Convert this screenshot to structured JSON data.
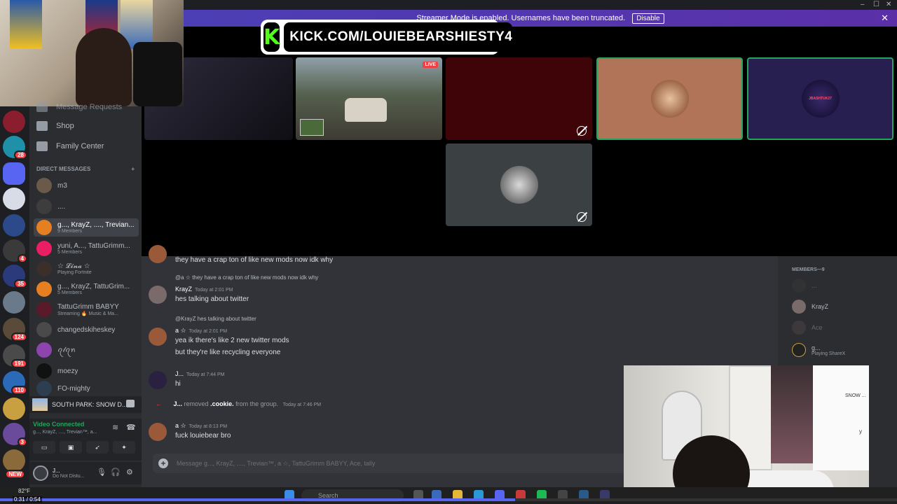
{
  "banner": {
    "text": "Streamer Mode is enabled. Usernames have been truncated.",
    "disable_label": "Disable",
    "close_label": "✕"
  },
  "window_controls": [
    "–",
    "☐",
    "✕"
  ],
  "kick_overlay": {
    "logo_letter": "K",
    "url": "KICK.COM/LOUIEBEARSHIESTY4"
  },
  "stage": {
    "live_label": "LIVE",
    "tiles": [
      {
        "name": "stream-tile-room",
        "color": "#1b1925"
      },
      {
        "name": "stream-tile-gta",
        "color": "#6a6f5c"
      },
      {
        "name": "participant-tile-red",
        "color": "#3e0408"
      },
      {
        "name": "participant-tile-orange",
        "color": "#b27458"
      },
      {
        "name": "participant-tile-navy",
        "color": "#271f4f"
      },
      {
        "name": "participant-tile-gray",
        "color": "#3b4043"
      }
    ],
    "navy_avatar_text": "JBASHTUK27"
  },
  "servers": {
    "badges": [
      "28",
      "4",
      "35",
      "124",
      "191",
      "110",
      "3",
      "NEW"
    ]
  },
  "dm_sidebar": {
    "nav": {
      "message_requests": "Message Requests",
      "shop": "Shop",
      "family_center": "Family Center"
    },
    "header": "DIRECT MESSAGES",
    "add": "+",
    "items": [
      {
        "name": "m3",
        "sub": "",
        "color": "#6b5a4a"
      },
      {
        "name": "....",
        "sub": "",
        "color": "#3d3d3d"
      },
      {
        "name": "g..., KrayZ, ...., Trevian...",
        "sub": "9 Members",
        "color": "#e67e22"
      },
      {
        "name": "yuni, A..., TattuGrimm...",
        "sub": "5 Members",
        "color": "#e91e63"
      },
      {
        "name": "☆ 𝓛𝓲𝓷𝓪 ☆",
        "sub": "Playing Fortnite",
        "color": "#3a2f2a"
      },
      {
        "name": "g..., KrayZ, TattuGrim...",
        "sub": "5 Members",
        "color": "#e67e22"
      },
      {
        "name": "TattuGrimm BABYY",
        "sub": "Streaming 🔥 Music & Ma...",
        "color": "#5a1a2a"
      },
      {
        "name": "changedskiheskey",
        "sub": "",
        "color": "#4a4a4a"
      },
      {
        "name": "ꪖ𝓁ꪖꪀ",
        "sub": "",
        "color": "#8e44ad"
      },
      {
        "name": "moezy",
        "sub": "",
        "color": "#111111"
      },
      {
        "name": "FO-mighty",
        "sub": "",
        "color": "#2c3e50"
      }
    ],
    "activity": "SOUTH PARK: SNOW D...",
    "voice": {
      "status": "Video Connected",
      "sub": "g..., KrayZ, ...., Trevian™, a..."
    },
    "user": {
      "name": "J...",
      "status": "Do Not Distu..."
    }
  },
  "chat": {
    "messages": [
      {
        "type": "text",
        "text": "they have a crap ton of like new mods now idk why"
      },
      {
        "type": "reply",
        "text": "@a ☆ they have a crap ton of like new mods now idk why"
      },
      {
        "type": "msg",
        "author": "KrayZ",
        "time": "Today at 2:01 PM",
        "lines": [
          "hes talking about twitter"
        ]
      },
      {
        "type": "reply",
        "text": "@KrayZ hes talking about twitter"
      },
      {
        "type": "msg",
        "author": "a ☆",
        "time": "Today at 2:01 PM",
        "lines": [
          "yea ik there's like 2 new twitter mods",
          "but they're like recycling everyone"
        ]
      },
      {
        "type": "msg",
        "author": "J...",
        "time": "Today at 7:44 PM",
        "lines": [
          "hi"
        ]
      },
      {
        "type": "system",
        "actor": "J...",
        "action": "removed",
        "target": ".cookie.",
        "rest": "from the group.",
        "time": "Today at 7:46 PM"
      },
      {
        "type": "msg",
        "author": "a ☆",
        "time": "Today at 8:13 PM",
        "lines": [
          "fuck louiebear bro"
        ]
      }
    ],
    "composer_placeholder": "Message g..., KrayZ, ...., Trevian™, a ☆, TattuGrimm BABYY, Ace, tally"
  },
  "members": {
    "header": "MEMBERS—9",
    "list": [
      {
        "name": "...",
        "sub": "",
        "color": "#3a3a3a"
      },
      {
        "name": "KrayZ",
        "sub": "",
        "color": "#7a6a6a"
      },
      {
        "name": "Ace",
        "sub": "",
        "color": "#5a4a4a"
      },
      {
        "name": "g...",
        "sub": "Playing ShareX",
        "color": "#222222"
      }
    ],
    "peek_text_1": "SNOW ...",
    "peek_text_2": "y"
  },
  "taskbar": {
    "temp": "82°F",
    "search_label": "Search"
  },
  "video": {
    "timecode": "0:31 / 0:54",
    "progress": 0.574
  }
}
